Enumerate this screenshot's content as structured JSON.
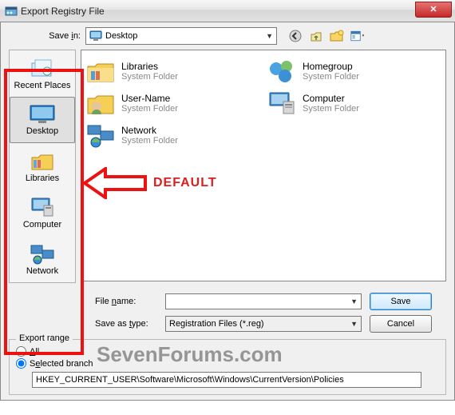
{
  "window": {
    "title": "Export Registry File"
  },
  "savein": {
    "label_pre": "Save ",
    "label_u": "i",
    "label_post": "n:",
    "value": "Desktop"
  },
  "places": [
    {
      "id": "recent",
      "label": "Recent Places"
    },
    {
      "id": "desktop",
      "label": "Desktop"
    },
    {
      "id": "libraries",
      "label": "Libraries"
    },
    {
      "id": "computer",
      "label": "Computer"
    },
    {
      "id": "network",
      "label": "Network"
    }
  ],
  "items": {
    "libraries": {
      "name": "Libraries",
      "sub": "System Folder"
    },
    "homegroup": {
      "name": "Homegroup",
      "sub": "System Folder"
    },
    "username": {
      "name": "User-Name",
      "sub": "System Folder"
    },
    "computer": {
      "name": "Computer",
      "sub": "System Folder"
    },
    "network": {
      "name": "Network",
      "sub": "System Folder"
    }
  },
  "fields": {
    "filename_label_pre": "File ",
    "filename_label_u": "n",
    "filename_label_post": "ame:",
    "filename_value": "",
    "saveastype_label_pre": "Save as ",
    "saveastype_label_u": "t",
    "saveastype_label_post": "ype:",
    "saveastype_value": "Registration Files (*.reg)"
  },
  "buttons": {
    "save": "Save",
    "cancel": "Cancel"
  },
  "export": {
    "legend": "Export range",
    "all_pre": "",
    "all_u": "A",
    "all_post": "ll",
    "selected_pre": "S",
    "selected_u": "e",
    "selected_post": "lected branch",
    "branch": "HKEY_CURRENT_USER\\Software\\Microsoft\\Windows\\CurrentVersion\\Policies"
  },
  "annotation": {
    "label": "DEFAULT"
  },
  "watermark": "SevenForums.com"
}
